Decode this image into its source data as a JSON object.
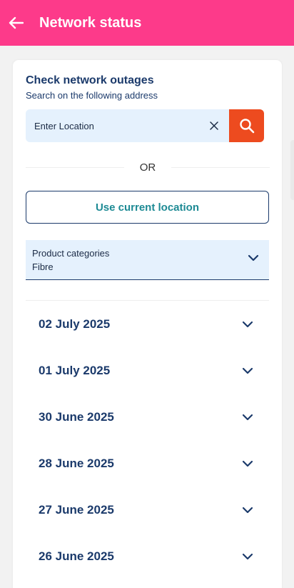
{
  "header": {
    "title": "Network status",
    "back_icon": "arrow-left-icon",
    "bg_color": "#fd3a8a"
  },
  "check": {
    "title": "Check network outages",
    "subtitle": "Search on the following address"
  },
  "search": {
    "placeholder": "Enter Location",
    "value": "",
    "clear_icon": "close-icon",
    "search_icon": "search-icon",
    "button_color": "#ed4b1f"
  },
  "divider_text": "OR",
  "current_location_label": "Use current location",
  "product_select": {
    "label": "Product categories",
    "value": "Fibre",
    "icon": "chevron-down-icon"
  },
  "dates": [
    {
      "label": "02 July 2025"
    },
    {
      "label": "01 July 2025"
    },
    {
      "label": "30 June 2025"
    },
    {
      "label": "28 June 2025"
    },
    {
      "label": "27 June 2025"
    },
    {
      "label": "26 June 2025"
    }
  ],
  "colors": {
    "navy": "#1b3a6b",
    "teal": "#1d8a94",
    "field_bg": "#e5f1fd"
  }
}
